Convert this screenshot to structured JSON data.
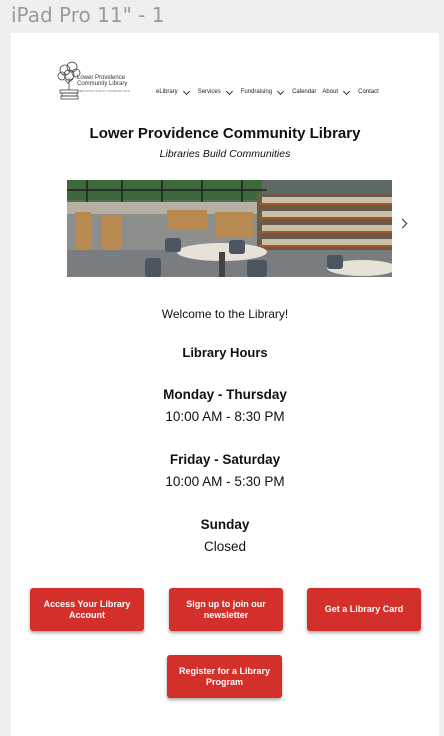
{
  "frame": {
    "title": "iPad Pro 11\" - 1"
  },
  "header": {
    "logo": {
      "line1": "Lower Providence",
      "line2": "Community Library",
      "tagline": "LIBRARIES BUILD COMMUNITIES"
    },
    "nav": [
      {
        "label": "eLibrary",
        "dropdown": true
      },
      {
        "label": "Services",
        "dropdown": true
      },
      {
        "label": "Fundraising",
        "dropdown": true
      },
      {
        "label": "Calendar",
        "dropdown": false
      },
      {
        "label": "About",
        "dropdown": true
      },
      {
        "label": "Contact",
        "dropdown": false
      }
    ]
  },
  "main": {
    "title": "Lower Providence Community Library",
    "subtitle": "Libraries Build Communities",
    "welcome": "Welcome to the Library!",
    "hours": {
      "title": "Library Hours",
      "schedule": [
        {
          "days": "Monday - Thursday",
          "time": "10:00 AM - 8:30 PM"
        },
        {
          "days": "Friday - Saturday",
          "time": "10:00 AM - 5:30 PM"
        },
        {
          "days": "Sunday",
          "time": "Closed"
        }
      ]
    },
    "buttons": {
      "access_account": "Access Your Library Account",
      "newsletter": "Sign up to join our newsletter",
      "library_card": "Get a Library Card",
      "register_program": "Register for a Library Program"
    }
  },
  "colors": {
    "button": "#d3302c",
    "background": "#efefef",
    "page": "#ffffff"
  }
}
